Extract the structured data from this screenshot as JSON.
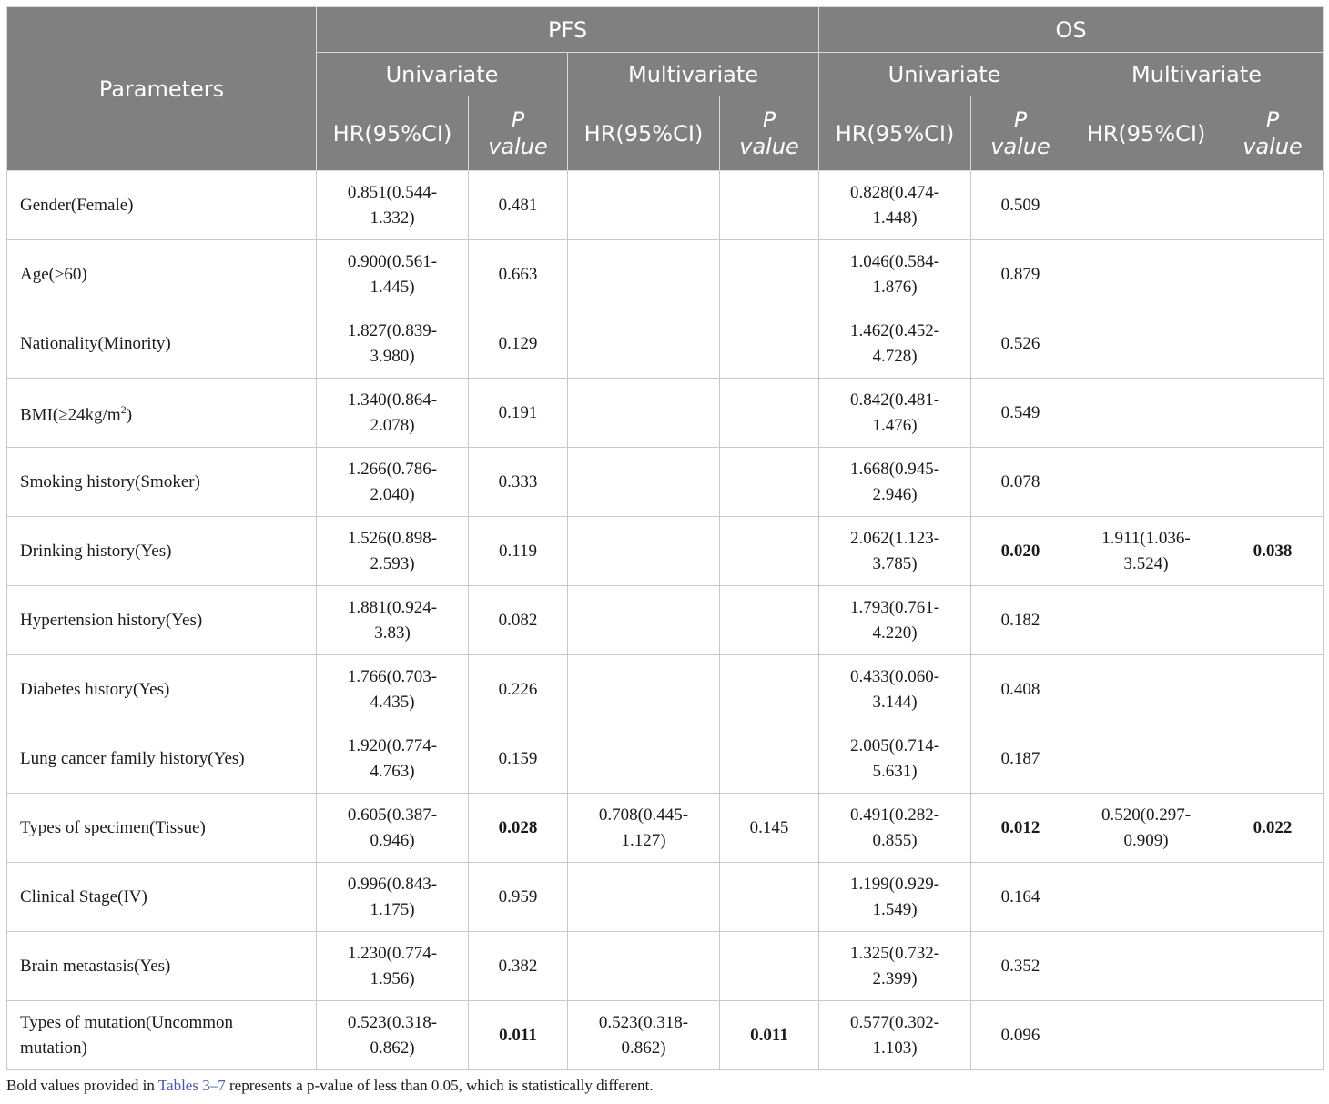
{
  "header": {
    "parameters": "Parameters",
    "pfs": "PFS",
    "os": "OS",
    "univariate": "Univariate",
    "multivariate": "Multivariate",
    "hr": "HR(95%CI)",
    "p": "P",
    "value": "value"
  },
  "rows": [
    {
      "param": "Gender(Female)",
      "pfs_uni_hr_a": "0.851(0.544-",
      "pfs_uni_hr_b": "1.332)",
      "pfs_uni_p": "0.481",
      "pfs_mul_hr_a": "",
      "pfs_mul_hr_b": "",
      "pfs_mul_p": "",
      "os_uni_hr_a": "0.828(0.474-",
      "os_uni_hr_b": "1.448)",
      "os_uni_p": "0.509",
      "os_mul_hr_a": "",
      "os_mul_hr_b": "",
      "os_mul_p": ""
    },
    {
      "param": "Age(≥60)",
      "pfs_uni_hr_a": "0.900(0.561-",
      "pfs_uni_hr_b": "1.445)",
      "pfs_uni_p": "0.663",
      "pfs_mul_hr_a": "",
      "pfs_mul_hr_b": "",
      "pfs_mul_p": "",
      "os_uni_hr_a": "1.046(0.584-",
      "os_uni_hr_b": "1.876)",
      "os_uni_p": "0.879",
      "os_mul_hr_a": "",
      "os_mul_hr_b": "",
      "os_mul_p": ""
    },
    {
      "param": "Nationality(Minority)",
      "pfs_uni_hr_a": "1.827(0.839-",
      "pfs_uni_hr_b": "3.980)",
      "pfs_uni_p": "0.129",
      "pfs_mul_hr_a": "",
      "pfs_mul_hr_b": "",
      "pfs_mul_p": "",
      "os_uni_hr_a": "1.462(0.452-",
      "os_uni_hr_b": "4.728)",
      "os_uni_p": "0.526",
      "os_mul_hr_a": "",
      "os_mul_hr_b": "",
      "os_mul_p": ""
    },
    {
      "param": "BMI(≥24kg/m",
      "param_sup": "2",
      "param_tail": ")",
      "pfs_uni_hr_a": "1.340(0.864-",
      "pfs_uni_hr_b": "2.078)",
      "pfs_uni_p": "0.191",
      "pfs_mul_hr_a": "",
      "pfs_mul_hr_b": "",
      "pfs_mul_p": "",
      "os_uni_hr_a": "0.842(0.481-",
      "os_uni_hr_b": "1.476)",
      "os_uni_p": "0.549",
      "os_mul_hr_a": "",
      "os_mul_hr_b": "",
      "os_mul_p": ""
    },
    {
      "param": "Smoking history(Smoker)",
      "pfs_uni_hr_a": "1.266(0.786-",
      "pfs_uni_hr_b": "2.040)",
      "pfs_uni_p": "0.333",
      "pfs_mul_hr_a": "",
      "pfs_mul_hr_b": "",
      "pfs_mul_p": "",
      "os_uni_hr_a": "1.668(0.945-",
      "os_uni_hr_b": "2.946)",
      "os_uni_p": "0.078",
      "os_mul_hr_a": "",
      "os_mul_hr_b": "",
      "os_mul_p": ""
    },
    {
      "param": "Drinking history(Yes)",
      "pfs_uni_hr_a": "1.526(0.898-",
      "pfs_uni_hr_b": "2.593)",
      "pfs_uni_p": "0.119",
      "pfs_mul_hr_a": "",
      "pfs_mul_hr_b": "",
      "pfs_mul_p": "",
      "os_uni_hr_a": "2.062(1.123-",
      "os_uni_hr_b": "3.785)",
      "os_uni_p": "0.020",
      "os_mul_hr_a": "1.911(1.036-",
      "os_mul_hr_b": "3.524)",
      "os_mul_p": "0.038"
    },
    {
      "param": "Hypertension history(Yes)",
      "pfs_uni_hr_a": "1.881(0.924-",
      "pfs_uni_hr_b": "3.83)",
      "pfs_uni_p": "0.082",
      "pfs_mul_hr_a": "",
      "pfs_mul_hr_b": "",
      "pfs_mul_p": "",
      "os_uni_hr_a": "1.793(0.761-",
      "os_uni_hr_b": "4.220)",
      "os_uni_p": "0.182",
      "os_mul_hr_a": "",
      "os_mul_hr_b": "",
      "os_mul_p": ""
    },
    {
      "param": "Diabetes history(Yes)",
      "pfs_uni_hr_a": "1.766(0.703-",
      "pfs_uni_hr_b": "4.435)",
      "pfs_uni_p": "0.226",
      "pfs_mul_hr_a": "",
      "pfs_mul_hr_b": "",
      "pfs_mul_p": "",
      "os_uni_hr_a": "0.433(0.060-",
      "os_uni_hr_b": "3.144)",
      "os_uni_p": "0.408",
      "os_mul_hr_a": "",
      "os_mul_hr_b": "",
      "os_mul_p": ""
    },
    {
      "param": "Lung cancer family history(Yes)",
      "pfs_uni_hr_a": "1.920(0.774-",
      "pfs_uni_hr_b": "4.763)",
      "pfs_uni_p": "0.159",
      "pfs_mul_hr_a": "",
      "pfs_mul_hr_b": "",
      "pfs_mul_p": "",
      "os_uni_hr_a": "2.005(0.714-",
      "os_uni_hr_b": "5.631)",
      "os_uni_p": "0.187",
      "os_mul_hr_a": "",
      "os_mul_hr_b": "",
      "os_mul_p": ""
    },
    {
      "param": "Types of specimen(Tissue)",
      "pfs_uni_hr_a": "0.605(0.387-",
      "pfs_uni_hr_b": "0.946)",
      "pfs_uni_p": "0.028",
      "pfs_mul_hr_a": "0.708(0.445-",
      "pfs_mul_hr_b": "1.127)",
      "pfs_mul_p": "0.145",
      "os_uni_hr_a": "0.491(0.282-",
      "os_uni_hr_b": "0.855)",
      "os_uni_p": "0.012",
      "os_mul_hr_a": "0.520(0.297-",
      "os_mul_hr_b": "0.909)",
      "os_mul_p": "0.022"
    },
    {
      "param": "Clinical Stage(IV)",
      "pfs_uni_hr_a": "0.996(0.843-",
      "pfs_uni_hr_b": "1.175)",
      "pfs_uni_p": "0.959",
      "pfs_mul_hr_a": "",
      "pfs_mul_hr_b": "",
      "pfs_mul_p": "",
      "os_uni_hr_a": "1.199(0.929-",
      "os_uni_hr_b": "1.549)",
      "os_uni_p": "0.164",
      "os_mul_hr_a": "",
      "os_mul_hr_b": "",
      "os_mul_p": ""
    },
    {
      "param": "Brain metastasis(Yes)",
      "pfs_uni_hr_a": "1.230(0.774-",
      "pfs_uni_hr_b": "1.956)",
      "pfs_uni_p": "0.382",
      "pfs_mul_hr_a": "",
      "pfs_mul_hr_b": "",
      "pfs_mul_p": "",
      "os_uni_hr_a": "1.325(0.732-",
      "os_uni_hr_b": "2.399)",
      "os_uni_p": "0.352",
      "os_mul_hr_a": "",
      "os_mul_hr_b": "",
      "os_mul_p": ""
    },
    {
      "param": "Types of mutation(Uncommon",
      "param_line2": "mutation)",
      "pfs_uni_hr_a": "0.523(0.318-",
      "pfs_uni_hr_b": "0.862)",
      "pfs_uni_p": "0.011",
      "pfs_mul_hr_a": "0.523(0.318-",
      "pfs_mul_hr_b": "0.862)",
      "pfs_mul_p": "0.011",
      "os_uni_hr_a": "0.577(0.302-",
      "os_uni_hr_b": "1.103)",
      "os_uni_p": "0.096",
      "os_mul_hr_a": "",
      "os_mul_hr_b": "",
      "os_mul_p": ""
    }
  ],
  "footnote": {
    "prefix": "Bold values provided in ",
    "link": "Tables 3–7",
    "suffix": " represents a p-value of less than 0.05, which is statistically different."
  }
}
